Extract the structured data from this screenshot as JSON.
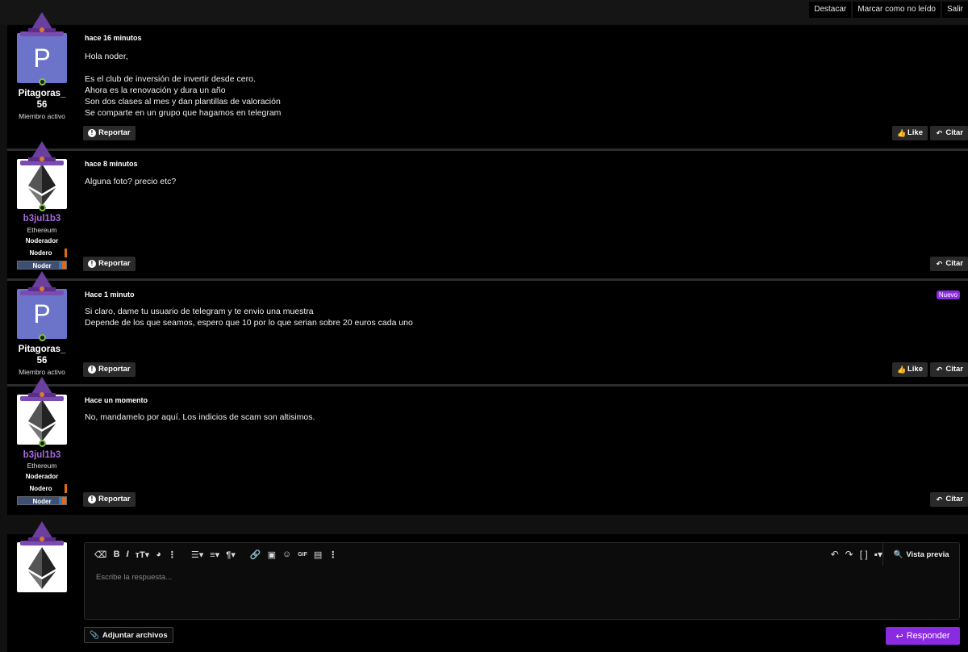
{
  "topbar": {
    "buttons": [
      "Destacar",
      "Marcar como no leído",
      "Salir"
    ]
  },
  "posts": [
    {
      "date": "hace 16 minutos",
      "body": "Hola noder,\n\nEs el club de inversión de invertir desde cero.\nAhora es la renovación y dura un año\nSon dos clases al mes y dan plantillas de valoración\nSe comparte en un grupo que hagamos en telegram",
      "user": {
        "name": "Pitagoras_\n56",
        "title": "Miembro activo",
        "avatar_letter": "P"
      },
      "report": "Reportar",
      "like": "Like",
      "quote": "Citar"
    },
    {
      "date": "hace 8 minutos",
      "body": "Alguna foto? precio etc?",
      "user": {
        "name": "b3jul1b3",
        "title": "Ethereum",
        "badges": [
          "Noderador",
          "Nodero",
          "Noder"
        ]
      },
      "report": "Reportar",
      "quote": "Citar"
    },
    {
      "date": "Hace 1 minuto",
      "body": "Si claro, dame tu usuario de telegram y te envio una muestra\nDepende de los que seamos, espero que 10 por lo que serian sobre 20 euros cada uno",
      "badge": "Nuevo",
      "user": {
        "name": "Pitagoras_\n56",
        "title": "Miembro activo",
        "avatar_letter": "P"
      },
      "report": "Reportar",
      "like": "Like",
      "quote": "Citar"
    },
    {
      "date": "Hace un momento",
      "body": "No, mandamelo por aquí. Los indicios de scam son altisimos.",
      "user": {
        "name": "b3jul1b3",
        "title": "Ethereum",
        "badges": [
          "Noderador",
          "Nodero",
          "Noder"
        ]
      },
      "report": "Reportar",
      "quote": "Citar"
    }
  ],
  "editor": {
    "placeholder": "Escribe la respuesta...",
    "preview": "Vista previa",
    "gif": "GIF",
    "attach": "Adjuntar archivos",
    "submit": "Responder"
  },
  "colors": {
    "accent": "#8a2be2",
    "online": "#7ec242",
    "moderator_name": "#a86be0",
    "avatar_p": "#6b74c9"
  }
}
